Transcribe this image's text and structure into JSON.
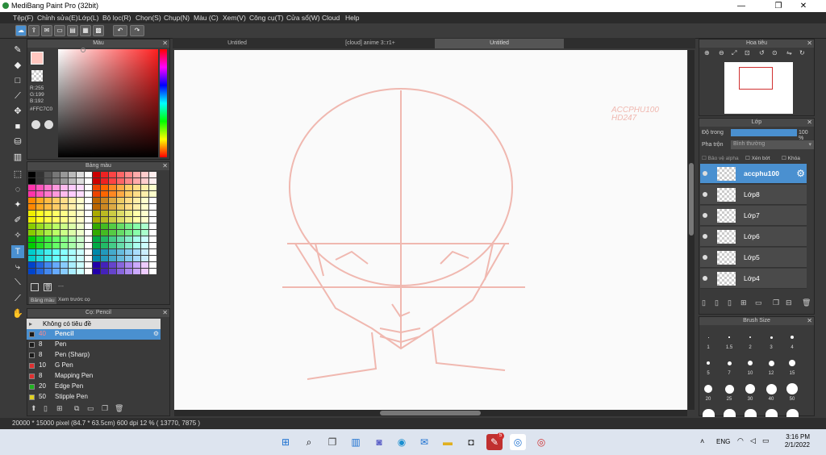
{
  "title": "MediBang Paint Pro (32bit)",
  "menu": [
    "Tệp(F)",
    "Chỉnh sửa(E)",
    "Lớp(L)",
    "Bộ lọc(R)",
    "Chọn(S)",
    "Chụp(N)",
    "Màu (C)",
    "Xem(V)",
    "Công cụ(T)",
    "Cửa sổ(W)",
    "Cloud",
    "Help"
  ],
  "color_panel": {
    "title": "Màu",
    "r": "R:255",
    "g": "G:199",
    "b": "B:192",
    "hex": "#FFC7C0",
    "fg": "#ffc7c0"
  },
  "palette_panel": {
    "title": "Bảng màu",
    "tabs": [
      "Bảng màu",
      "Xem trước cọ"
    ],
    "dots": "---"
  },
  "brush_panel": {
    "title": "Cọ: Pencil",
    "header": "Không có tiêu đề",
    "brushes": [
      {
        "size": "40",
        "name": "Pencil",
        "color": "#1a1a1a",
        "selected": true
      },
      {
        "size": "8",
        "name": "Pen",
        "color": "#1a1a1a"
      },
      {
        "size": "8",
        "name": "Pen (Sharp)",
        "color": "#1a1a1a"
      },
      {
        "size": "10",
        "name": "G Pen",
        "color": "#e03030"
      },
      {
        "size": "8",
        "name": "Mapping Pen",
        "color": "#e03030"
      },
      {
        "size": "20",
        "name": "Edge Pen",
        "color": "#20b020"
      },
      {
        "size": "50",
        "name": "Stipple Pen",
        "color": "#e0d020"
      }
    ]
  },
  "tabs": [
    "Untitled",
    "[cloud] anime 3::r1+",
    "Untitled"
  ],
  "watermark": [
    "ACCPHU100",
    "HD247"
  ],
  "navigator": {
    "title": "Hoa tiêu"
  },
  "layer_panel": {
    "title": "Lớp",
    "opacity_label": "Độ trong",
    "opacity_value": "100 %",
    "blend_label": "Pha trộn",
    "blend_value": "Bình thường",
    "checks": [
      "Bảo vệ alpha",
      "Xén bớt",
      "Khóa"
    ],
    "layers": [
      "accphu100",
      "Lớp8",
      "Lớp7",
      "Lớp6",
      "Lớp5",
      "Lớp4"
    ]
  },
  "brush_size": {
    "title": "Brush Size",
    "sizes": [
      "1",
      "1.5",
      "2",
      "3",
      "4",
      "5",
      "7",
      "10",
      "12",
      "15",
      "20",
      "25",
      "30",
      "40",
      "50"
    ]
  },
  "status": {
    "text": "20000 * 15000 pixel   (84.7 * 63.5cm)   600 dpi   12 %   ( 13770, 7875 )"
  },
  "taskbar": {
    "lang": "ENG",
    "time": "3:16 PM",
    "date": "2/1/2022",
    "badge": "5"
  },
  "colors": {
    "accent": "#4a90d0",
    "sketch": "#f0b8b0"
  }
}
